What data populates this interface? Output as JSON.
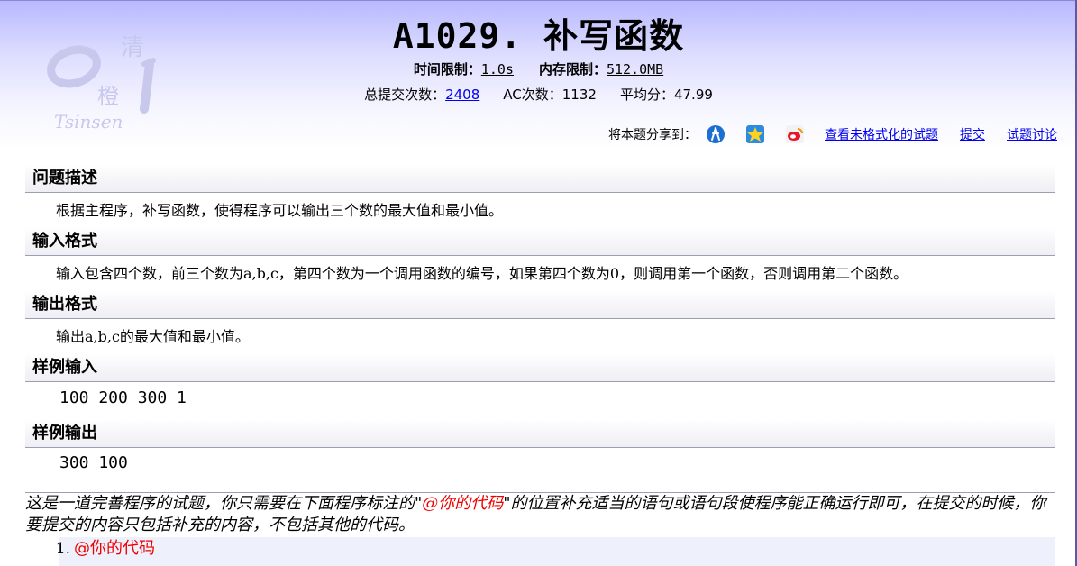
{
  "header": {
    "logo": {
      "top_char": "清",
      "bottom_char": "橙",
      "letters": "Tsinsen"
    },
    "title": "A1029.  补写函数",
    "time_limit_label": "时间限制：",
    "time_limit_value": "1.0s",
    "memory_limit_label": "内存限制：",
    "memory_limit_value": "512.0MB",
    "submissions_label": "总提交次数：",
    "submissions_value": "2408",
    "ac_label": "AC次数：",
    "ac_value": "1132",
    "avg_label": "平均分：",
    "avg_value": "47.99"
  },
  "share": {
    "label": "将本题分享到：",
    "icons": [
      "renren-icon",
      "qzone-icon",
      "weibo-icon"
    ],
    "view_unformatted": "查看未格式化的试题",
    "submit": "提交",
    "discuss": "试题讨论"
  },
  "sections": {
    "description_title": "问题描述",
    "description_body": "根据主程序，补写函数，使得程序可以输出三个数的最大值和最小值。",
    "input_title": "输入格式",
    "input_body": "输入包含四个数，前三个数为a,b,c，第四个数为一个调用函数的编号，如果第四个数为0，则调用第一个函数，否则调用第二个函数。",
    "output_title": "输出格式",
    "output_body": "输出a,b,c的最大值和最小值。",
    "sample_input_title": "样例输入",
    "sample_input_body": "100 200 300 1",
    "sample_output_title": "样例输出",
    "sample_output_body": "300 100"
  },
  "note": {
    "part1": "这是一道完善程序的试题，你只需要在下面程序标注的\"",
    "highlight": "@你的代码",
    "part2": "\"的位置补充适当的语句或语句段使程序能正确运行即可，在提交的时候，你要提交的内容只包括补充的内容，不包括其他的代码。"
  },
  "code": {
    "line_number": "1.",
    "line_text": "@你的代码"
  },
  "colors": {
    "link": "#0000ee",
    "highlight": "#ee0000",
    "header_gradient_top": "#b8b8ff"
  }
}
